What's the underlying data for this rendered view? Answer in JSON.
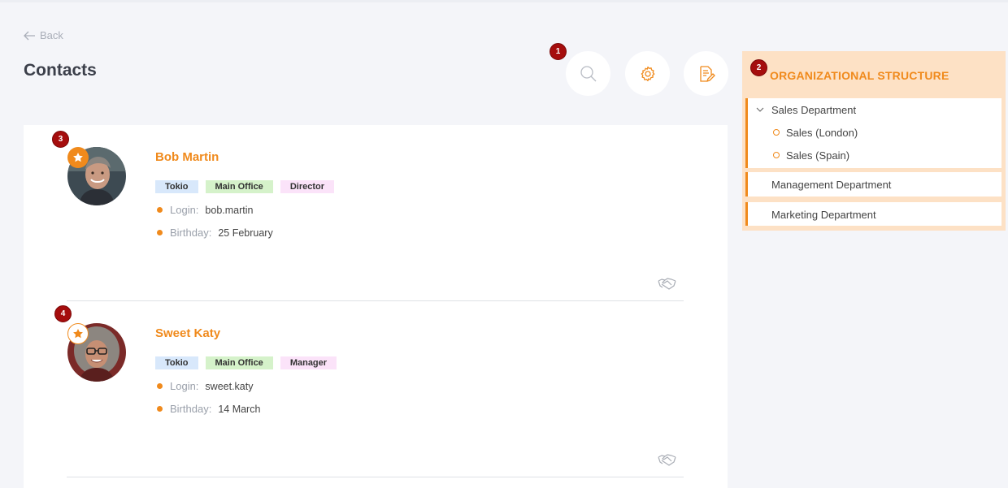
{
  "nav": {
    "back_label": "Back"
  },
  "page": {
    "title": "Contacts"
  },
  "badges": [
    "1",
    "2",
    "3",
    "4"
  ],
  "toolbar": {
    "buttons": [
      {
        "icon": "search-icon"
      },
      {
        "icon": "gear-icon"
      },
      {
        "icon": "document-edit-icon"
      }
    ]
  },
  "org": {
    "title": "ORGANIZATIONAL STRUCTURE",
    "departments": [
      {
        "label": "Sales Department",
        "expanded": true,
        "children": [
          {
            "label": "Sales (London)"
          },
          {
            "label": "Sales (Spain)"
          }
        ]
      },
      {
        "label": "Management Department"
      },
      {
        "label": "Marketing Department"
      }
    ]
  },
  "contacts": [
    {
      "name": "Bob Martin",
      "favorite": true,
      "tags": [
        "Tokio",
        "Main Office",
        "Director"
      ],
      "login_label": "Login:",
      "login": "bob.martin",
      "birthday_label": "Birthday:",
      "birthday": "25 February"
    },
    {
      "name": "Sweet Katy",
      "favorite": false,
      "tags": [
        "Tokio",
        "Main Office",
        "Manager"
      ],
      "login_label": "Login:",
      "login": "sweet.katy",
      "birthday_label": "Birthday:",
      "birthday": "14 March"
    }
  ],
  "colors": {
    "accent": "#f08a1c",
    "badge": "#a50d0d",
    "org_bg": "#fde1c5",
    "page_bg": "#f4f5f9"
  }
}
